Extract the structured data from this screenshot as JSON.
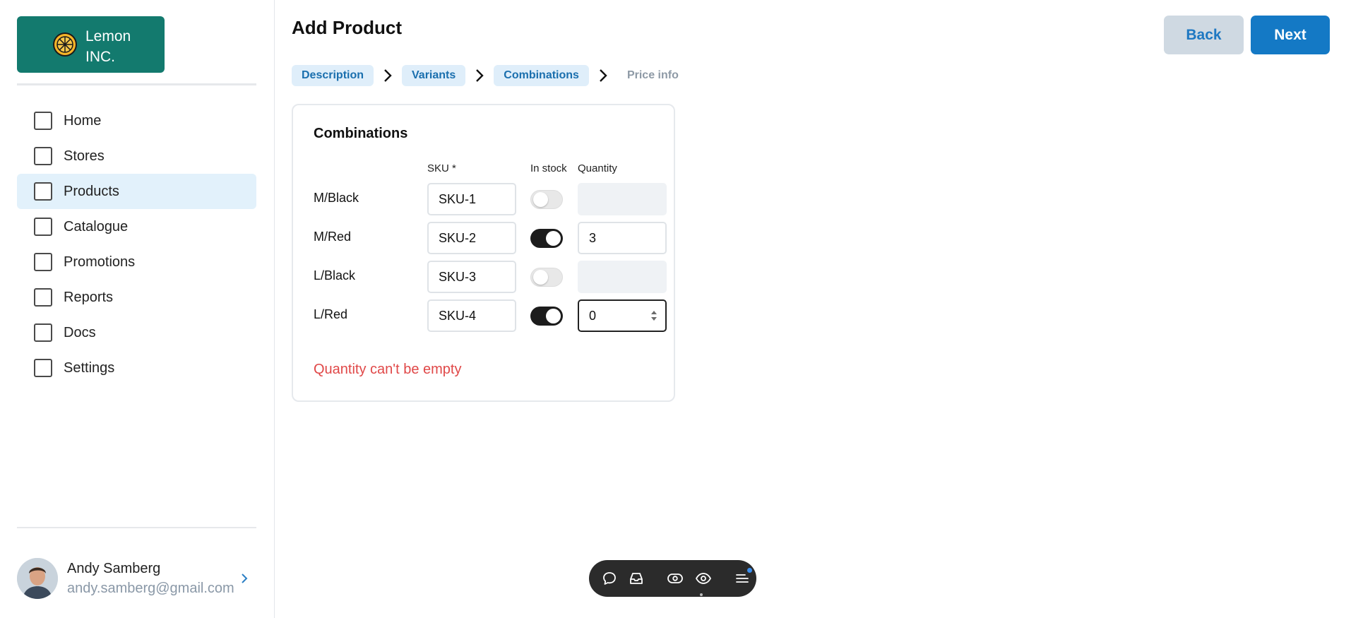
{
  "brand": {
    "line1": "Lemon",
    "line2": "INC."
  },
  "sidebar": {
    "items": [
      {
        "label": "Home",
        "active": false
      },
      {
        "label": "Stores",
        "active": false
      },
      {
        "label": "Products",
        "active": true
      },
      {
        "label": "Catalogue",
        "active": false
      },
      {
        "label": "Promotions",
        "active": false
      },
      {
        "label": "Reports",
        "active": false
      },
      {
        "label": "Docs",
        "active": false
      },
      {
        "label": "Settings",
        "active": false
      }
    ]
  },
  "user": {
    "name": "Andy Samberg",
    "email": "andy.samberg@gmail.com"
  },
  "header": {
    "title": "Add Product",
    "back_label": "Back",
    "next_label": "Next"
  },
  "steps": [
    {
      "label": "Description",
      "state": "done"
    },
    {
      "label": "Variants",
      "state": "done"
    },
    {
      "label": "Combinations",
      "state": "current"
    },
    {
      "label": "Price info",
      "state": "upcoming"
    }
  ],
  "combinations": {
    "title": "Combinations",
    "headers": {
      "sku": "SKU *",
      "in_stock": "In stock",
      "quantity": "Quantity"
    },
    "rows": [
      {
        "label": "M/Black",
        "sku": "SKU-1",
        "in_stock": false,
        "quantity": ""
      },
      {
        "label": "M/Red",
        "sku": "SKU-2",
        "in_stock": true,
        "quantity": "3"
      },
      {
        "label": "L/Black",
        "sku": "SKU-3",
        "in_stock": false,
        "quantity": ""
      },
      {
        "label": "L/Red",
        "sku": "SKU-4",
        "in_stock": true,
        "quantity": "0"
      }
    ],
    "error": "Quantity can't be empty"
  },
  "colors": {
    "brand": "#137a6e",
    "primary": "#1479c5",
    "active_nav_bg": "#e2f1fb",
    "error": "#e04848"
  },
  "toolbar": {
    "icons": [
      "comment-icon",
      "inbox-icon",
      "preview-icon",
      "eye-icon",
      "menu-icon"
    ]
  }
}
